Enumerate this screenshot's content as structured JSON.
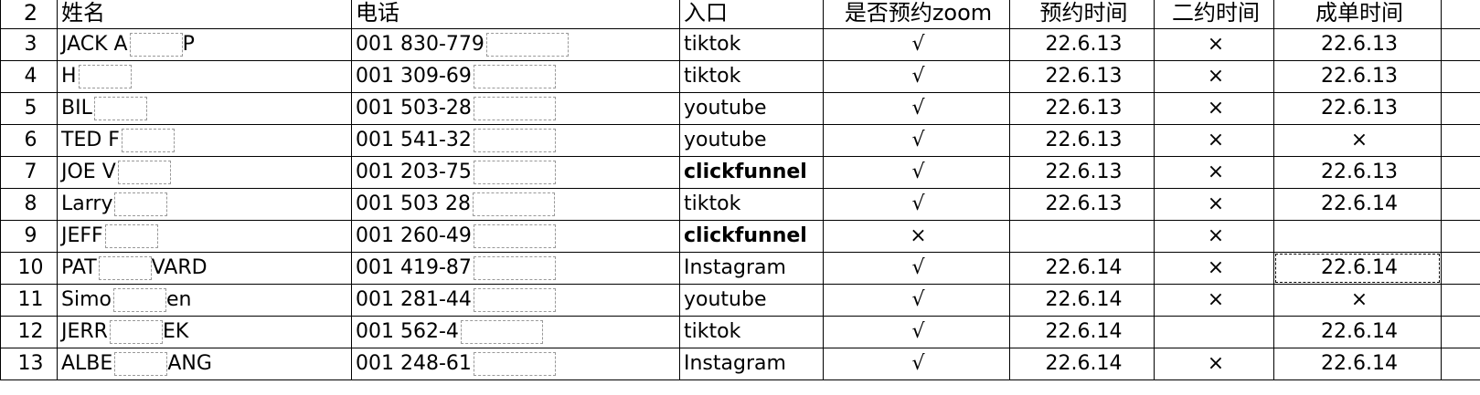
{
  "header": {
    "rownum": "2",
    "name": "姓名",
    "phone": "电话",
    "entry": "入口",
    "zoom": "是否预约zoom",
    "appt_time": "预约时间",
    "second_time": "二约时间",
    "deal_time": "成单时间"
  },
  "rows": [
    {
      "rownum": "3",
      "name": "JACK A",
      "name_tail": "P",
      "phone": "001 830-779",
      "entry": "tiktok",
      "zoom": "√",
      "appt": "22.6.13",
      "second": "×",
      "deal": "22.6.13"
    },
    {
      "rownum": "4",
      "name": "H",
      "name_tail": "",
      "phone": "001 309-69",
      "entry": "tiktok",
      "zoom": "√",
      "appt": "22.6.13",
      "second": "×",
      "deal": "22.6.13"
    },
    {
      "rownum": "5",
      "name": "BIL",
      "name_tail": "",
      "phone": "001 503-28",
      "entry": "youtube",
      "zoom": "√",
      "appt": "22.6.13",
      "second": "×",
      "deal": "22.6.13"
    },
    {
      "rownum": "6",
      "name": "TED F",
      "name_tail": "",
      "phone": "001 541-32",
      "entry": "youtube",
      "zoom": "√",
      "appt": "22.6.13",
      "second": "×",
      "deal": "×"
    },
    {
      "rownum": "7",
      "name": "JOE V",
      "name_tail": "",
      "phone": "001 203-75",
      "entry": "clickfunnel",
      "zoom": "√",
      "appt": "22.6.13",
      "second": "×",
      "deal": "22.6.13"
    },
    {
      "rownum": "8",
      "name": "Larry",
      "name_tail": "",
      "phone": "001 503 28",
      "entry": "tiktok",
      "zoom": "√",
      "appt": "22.6.13",
      "second": "×",
      "deal": "22.6.14"
    },
    {
      "rownum": "9",
      "name": "JEFF",
      "name_tail": "",
      "phone": "001 260-49",
      "entry": "clickfunnel",
      "zoom": "×",
      "appt": "",
      "second": "×",
      "deal": ""
    },
    {
      "rownum": "10",
      "name": "PAT",
      "name_tail": "VARD",
      "phone": "001 419-87",
      "entry": "Instagram",
      "zoom": "√",
      "appt": "22.6.14",
      "second": "×",
      "deal": "22.6.14"
    },
    {
      "rownum": "11",
      "name": "Simo",
      "name_tail": "en",
      "phone": "001 281-44",
      "entry": "youtube",
      "zoom": "√",
      "appt": "22.6.14",
      "second": "×",
      "deal": "×"
    },
    {
      "rownum": "12",
      "name": "JERR",
      "name_tail": "EK",
      "phone": "001 562-4",
      "entry": "tiktok",
      "zoom": "√",
      "appt": "22.6.14",
      "second": "",
      "deal": "22.6.14"
    },
    {
      "rownum": "13",
      "name": "ALBE",
      "name_tail": "ANG",
      "phone": "001 248-61",
      "entry": "Instagram",
      "zoom": "√",
      "appt": "22.6.14",
      "second": "×",
      "deal": "22.6.14"
    }
  ]
}
